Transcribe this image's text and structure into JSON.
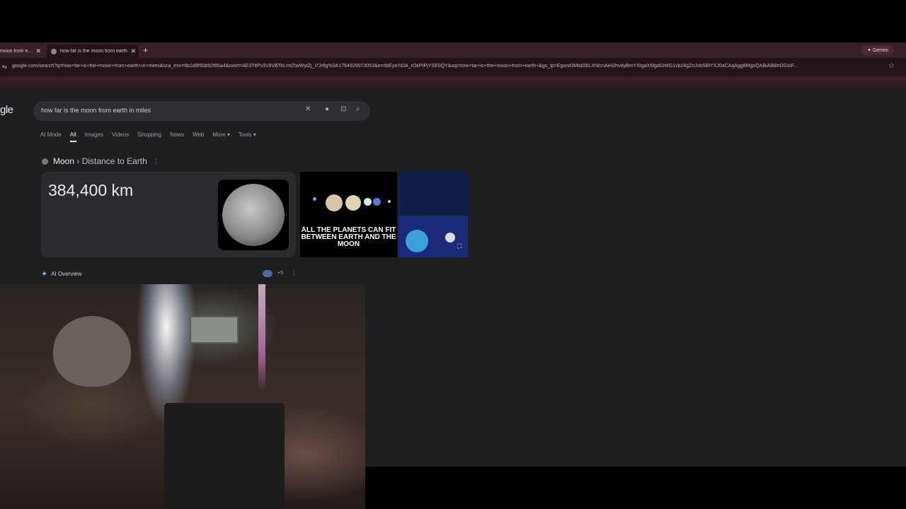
{
  "browser": {
    "tabs": [
      {
        "title": "moon from earth",
        "close": "✕"
      },
      {
        "title": "how far is the moon from earth",
        "close": "✕",
        "active": true
      }
    ],
    "new_tab": "+",
    "gemini_label": "✦ Gemini",
    "url": "google.com/search?q=how+far+is+the+moon+from+earth+in+miles&sca_esv=6b1d8f50b92f85a4&sxsrf=AE3TifPv3V8VBToLmtZlwWytZj_i7Jr8g%3A1764929973053&ei=tbEyaYiDA_rOkPIPjYSE0QY&oq=how+far+is+the+moon+from+earth+&gs_lp=Egxnd3Mtd2l6LXNlcnAiH2hvdyBmYXIgaXMgdGhlIG1vb24gZnJvbSBlYXJ0aCAqAgg8MgoQABiABBhDGIoF..."
  },
  "search": {
    "logo": "gle",
    "query": "how far is the moon from earth in miles",
    "tabs": [
      "AI Mode",
      "All",
      "Images",
      "Videos",
      "Shopping",
      "News",
      "Web",
      "More ▾",
      "Tools ▾"
    ],
    "active_tab": "All"
  },
  "knowledge_panel": {
    "entity": "Moon",
    "separator": " › ",
    "attribute": "Distance to Earth",
    "answer": "384,400 km",
    "planets_caption": "ALL THE PLANETS CAN FIT BETWEEN EARTH AND THE MOON"
  },
  "ai_overview": {
    "label": "AI Overview",
    "sources_count": "+5"
  },
  "icons": {
    "clear": "✕",
    "mic": "🎤",
    "lens": "⊡",
    "search": "🔍",
    "menu": "⋮",
    "star": "☆",
    "expand": "⛶",
    "ai": "✦"
  }
}
